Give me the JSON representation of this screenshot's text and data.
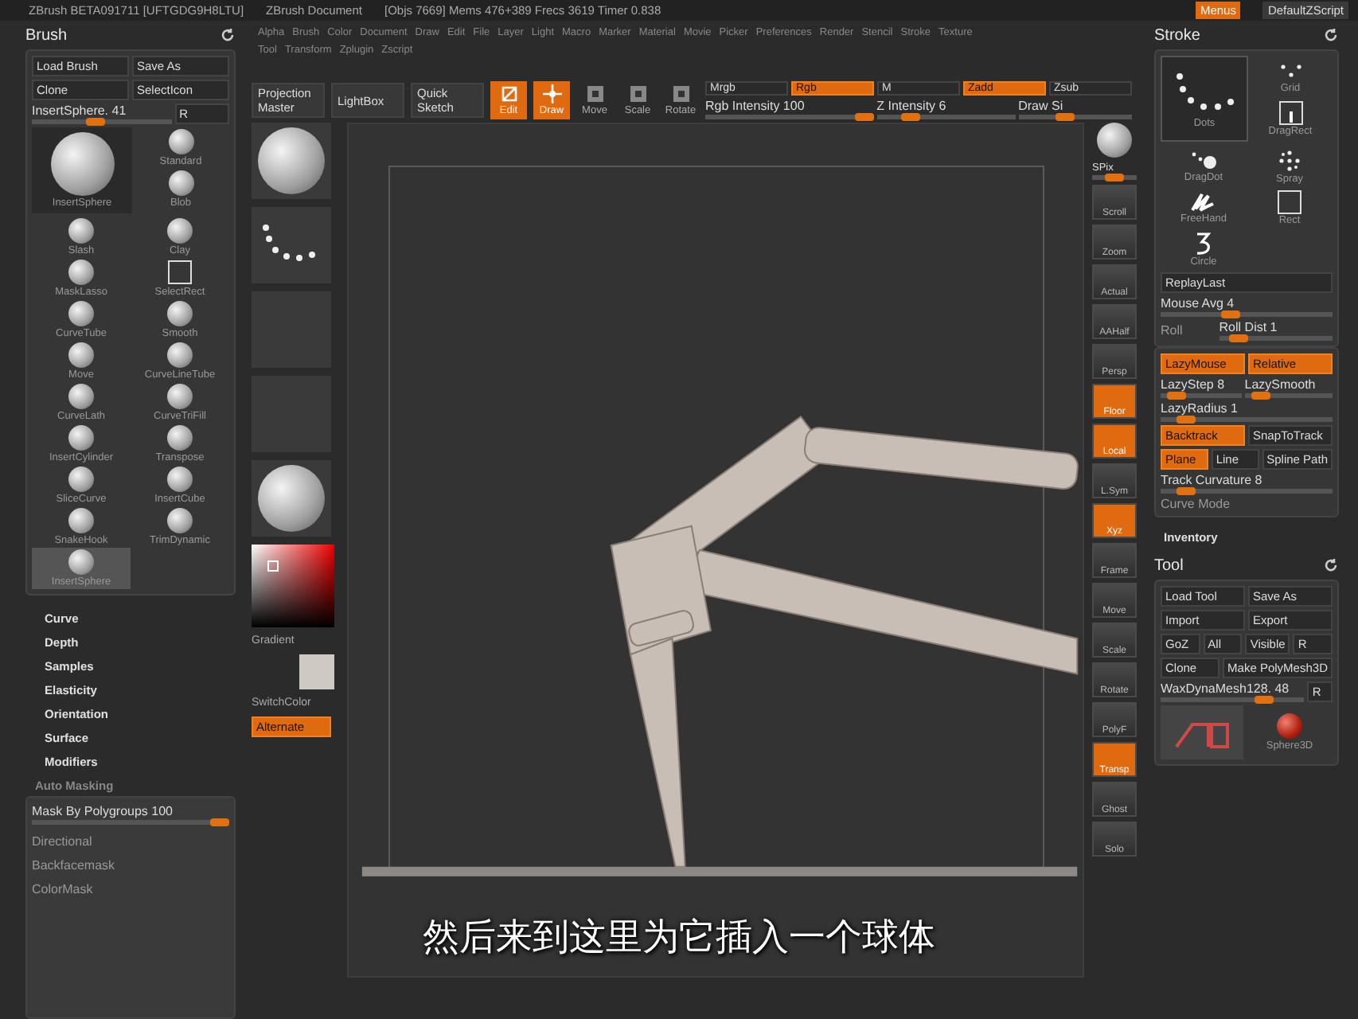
{
  "title_bar": {
    "app": "ZBrush BETA091711 [UFTGDG9H8LTU]",
    "document": "ZBrush Document",
    "stats": "[Objs 7669] Mems 476+389 Frecs 3619 Timer 0.838",
    "buttons": [
      {
        "label": "Menus",
        "on": true
      },
      {
        "label": "DefaultZScript",
        "on": false
      }
    ]
  },
  "menu_bar": {
    "rows": [
      [
        "Alpha",
        "Brush",
        "Color",
        "Document",
        "Draw",
        "Edit",
        "File",
        "Layer",
        "Light",
        "Macro",
        "Marker",
        "Material",
        "Movie",
        "Picker",
        "Preferences",
        "Render",
        "Stencil",
        "Stroke",
        "Texture"
      ],
      [
        "Tool",
        "Transform",
        "Zplugin",
        "Zscript"
      ]
    ]
  },
  "brush_palette": {
    "title": "Brush",
    "rows": [
      [
        {
          "label": "Load Brush",
          "kind": "button",
          "on": false
        },
        {
          "label": "Save As",
          "kind": "button",
          "on": false
        }
      ],
      [
        {
          "label": "Clone",
          "kind": "button",
          "on": false
        },
        {
          "label": "SelectIcon",
          "kind": "button",
          "on": false
        }
      ],
      [
        {
          "label": "InsertSphere. 41",
          "kind": "slider",
          "level": 0.45
        },
        {
          "label": "R",
          "kind": "button",
          "on": false
        }
      ]
    ],
    "current_brush": {
      "name": "InsertSphere",
      "selected": false
    },
    "brushes": [
      {
        "name": "Standard",
        "kind": "sphere",
        "selected": false
      },
      {
        "name": "Blob",
        "kind": "sphere",
        "selected": false
      },
      {
        "name": "Slash",
        "kind": "sphere",
        "selected": false
      },
      {
        "name": "Clay",
        "kind": "sphere",
        "selected": false
      },
      {
        "name": "MaskLasso",
        "kind": "sphere",
        "selected": false
      },
      {
        "name": "SelectRect",
        "kind": "rect",
        "selected": false
      },
      {
        "name": "CurveTube",
        "kind": "sphere",
        "selected": false
      },
      {
        "name": "Smooth",
        "kind": "sphere",
        "selected": false
      },
      {
        "name": "Move",
        "kind": "sphere",
        "selected": false
      },
      {
        "name": "CurveLineTube",
        "kind": "sphere",
        "selected": false
      },
      {
        "name": "CurveLath",
        "kind": "sphere",
        "selected": false
      },
      {
        "name": "CurveTriFill",
        "kind": "sphere",
        "selected": false
      },
      {
        "name": "InsertCylinder",
        "kind": "sphere",
        "selected": false
      },
      {
        "name": "Transpose",
        "kind": "sphere",
        "selected": false
      },
      {
        "name": "SliceCurve",
        "kind": "sphere",
        "selected": false
      },
      {
        "name": "InsertCube",
        "kind": "sphere",
        "selected": false
      },
      {
        "name": "SnakeHook",
        "kind": "sphere",
        "selected": false
      },
      {
        "name": "TrimDynamic",
        "kind": "sphere",
        "selected": false
      },
      {
        "name": "InsertSphere",
        "kind": "sphere",
        "selected": true
      }
    ],
    "sections": [
      "Curve",
      "Depth",
      "Samples",
      "Elasticity",
      "Orientation",
      "Surface",
      "Modifiers"
    ],
    "auto_masking": {
      "title": "Auto Masking",
      "rows": [
        [
          {
            "label": "Mask By Polygroups 100",
            "kind": "slider",
            "level": 1
          }
        ],
        [
          {
            "label": "Directional",
            "kind": "text"
          }
        ],
        [
          {
            "label": "Backfacemask",
            "kind": "text"
          }
        ],
        [
          {
            "label": "ColorMask",
            "kind": "text"
          }
        ]
      ]
    }
  },
  "toolbar": {
    "buttons": [
      {
        "label": "Projection Master",
        "kind": "text",
        "on": false
      },
      {
        "label": "LightBox",
        "kind": "text",
        "on": false
      },
      {
        "label": "Quick Sketch",
        "kind": "text",
        "on": false
      },
      {
        "label": "Edit",
        "kind": "edit",
        "on": true
      },
      {
        "label": "Draw",
        "kind": "draw",
        "on": true
      },
      {
        "label": "Move",
        "kind": "move",
        "on": false
      },
      {
        "label": "Scale",
        "kind": "scale",
        "on": false
      },
      {
        "label": "Rotate",
        "kind": "rotate",
        "on": false
      }
    ],
    "modes": [
      [
        {
          "label": "Mrgb",
          "kind": "button",
          "on": false
        },
        {
          "label": "Rgb",
          "kind": "button",
          "on": true
        },
        {
          "label": "M",
          "kind": "button",
          "on": false
        },
        {
          "label": "Zadd",
          "kind": "button",
          "on": true
        },
        {
          "label": "Zsub",
          "kind": "button",
          "on": false
        }
      ],
      [
        {
          "label": "Rgb Intensity 100",
          "kind": "slider",
          "level": 1
        },
        {
          "label": "Z Intensity 6",
          "kind": "slider",
          "level": 0.2
        },
        {
          "label": "Draw Si",
          "kind": "slider",
          "level": 0.4
        }
      ]
    ]
  },
  "shelf": {
    "thumbs": [
      {
        "kind": "sphere"
      },
      {
        "kind": "dots"
      },
      {
        "kind": "empty"
      },
      {
        "kind": "empty"
      },
      {
        "kind": "sphere"
      }
    ],
    "gradient_label": "Gradient",
    "switch_label": "SwitchColor",
    "alternate": {
      "label": "Alternate",
      "on": true
    }
  },
  "view_shelf": [
    {
      "label": "SPix",
      "kind": "slider",
      "level": 0.5
    },
    {
      "label": "Scroll",
      "kind": "icon",
      "on": false
    },
    {
      "label": "Zoom",
      "kind": "icon",
      "on": false
    },
    {
      "label": "Actual",
      "kind": "icon",
      "on": false
    },
    {
      "label": "AAHalf",
      "kind": "icon",
      "on": false
    },
    {
      "label": "Persp",
      "kind": "icon",
      "on": false
    },
    {
      "label": "Floor",
      "kind": "icon",
      "on": true
    },
    {
      "label": "Local",
      "kind": "icon",
      "on": true
    },
    {
      "label": "L.Sym",
      "kind": "icon",
      "on": false
    },
    {
      "label": "Xyz",
      "kind": "icon",
      "on": true
    },
    {
      "label": "Frame",
      "kind": "icon",
      "on": false
    },
    {
      "label": "Move",
      "kind": "icon",
      "on": false
    },
    {
      "label": "Scale",
      "kind": "icon",
      "on": false
    },
    {
      "label": "Rotate",
      "kind": "icon",
      "on": false
    },
    {
      "label": "PolyF",
      "kind": "icon",
      "on": false
    },
    {
      "label": "Transp",
      "kind": "icon",
      "on": true
    },
    {
      "label": "Ghost",
      "kind": "icon",
      "on": false
    },
    {
      "label": "Solo",
      "kind": "icon",
      "on": false
    }
  ],
  "stroke_palette": {
    "title": "Stroke",
    "current_stroke": {
      "name": "Dots",
      "selected": true
    },
    "strokes": [
      {
        "name": "Grid",
        "kind": "grid",
        "selected": false
      },
      {
        "name": "DragRect",
        "kind": "dragrect",
        "selected": false
      },
      {
        "name": "DragDot",
        "kind": "dragdot",
        "selected": false
      },
      {
        "name": "Spray",
        "kind": "spray",
        "selected": false
      },
      {
        "name": "FreeHand",
        "kind": "freehand",
        "selected": false
      },
      {
        "name": "Rect",
        "kind": "rect",
        "selected": false
      },
      {
        "name": "Circle",
        "kind": "circle",
        "selected": false
      }
    ],
    "rows": [
      [
        {
          "label": "ReplayLast",
          "kind": "button",
          "on": false
        }
      ],
      [
        {
          "label": "Mouse Avg 4",
          "kind": "slider",
          "level": 0.4
        }
      ],
      [
        {
          "label": "Roll",
          "kind": "text"
        },
        {
          "label": "Roll Dist 1",
          "kind": "slider",
          "level": 0.1
        }
      ]
    ],
    "lazy_rows": [
      [
        {
          "label": "LazyMouse",
          "kind": "button",
          "on": true
        },
        {
          "label": "Relative",
          "kind": "button",
          "on": true
        }
      ],
      [
        {
          "label": "LazyStep 8",
          "kind": "slider",
          "level": 0.1
        },
        {
          "label": "LazySmooth",
          "kind": "slider",
          "level": 0.1
        }
      ],
      [
        {
          "label": "LazyRadius 1",
          "kind": "slider",
          "level": 0.1
        }
      ],
      [
        {
          "label": "Backtrack",
          "kind": "button",
          "on": true
        },
        {
          "label": "SnapToTrack",
          "kind": "button",
          "on": false
        }
      ],
      [
        {
          "label": "Plane",
          "kind": "button",
          "on": true
        },
        {
          "label": "Line",
          "kind": "button",
          "on": false
        },
        {
          "label": "Spline Path",
          "kind": "button",
          "on": false
        }
      ],
      [
        {
          "label": "Track Curvature 8",
          "kind": "slider",
          "level": 0.1
        }
      ],
      [
        {
          "label": "Curve Mode",
          "kind": "text"
        }
      ]
    ],
    "inventory": "Inventory"
  },
  "tool_palette": {
    "title": "Tool",
    "rows": [
      [
        {
          "label": "Load Tool",
          "kind": "button",
          "on": false
        },
        {
          "label": "Save As",
          "kind": "button",
          "on": false
        }
      ],
      [
        {
          "label": "Import",
          "kind": "button",
          "on": false
        },
        {
          "label": "Export",
          "kind": "button",
          "on": false
        }
      ],
      [
        {
          "label": "GoZ",
          "kind": "button",
          "on": false
        },
        {
          "label": "All",
          "kind": "button",
          "on": false
        },
        {
          "label": "Visible",
          "kind": "button",
          "on": false
        },
        {
          "label": "R",
          "kind": "button",
          "on": false
        }
      ],
      [
        {
          "label": "Clone",
          "kind": "button",
          "on": false
        },
        {
          "label": "Make PolyMesh3D",
          "kind": "button",
          "on": false
        }
      ],
      [
        {
          "label": "WaxDynaMesh128. 48",
          "kind": "slider",
          "level": 0.75
        },
        {
          "label": "R",
          "kind": "button",
          "on": false
        }
      ]
    ],
    "secondary_tool": "Sphere3D"
  },
  "subtitle": "然后来到这里为它插入一个球体"
}
